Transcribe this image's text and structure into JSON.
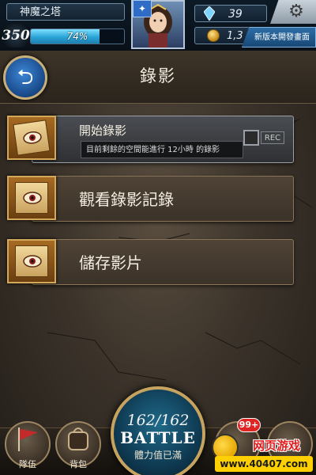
{
  "header": {
    "tower_name": "神魔之塔",
    "level": "350",
    "exp_percent": 74,
    "exp_label": "74%",
    "gems": "39",
    "coins": "1,3",
    "update_button": "新版本開發畫面"
  },
  "page": {
    "title": "錄影"
  },
  "menu": {
    "start": {
      "label": "開始錄影",
      "subtitle": "目前剩餘的空間能進行 12小時 的錄影",
      "toggle_label": "REC"
    },
    "view": {
      "label": "觀看錄影記錄"
    },
    "save": {
      "label": "儲存影片"
    }
  },
  "bottom": {
    "team_label": "隊伍",
    "bag_label": "背包",
    "stamina": "162/162",
    "battle_label": "BATTLE",
    "stamina_status": "體力值已滿",
    "badge": "99+"
  },
  "watermark": {
    "title": "网页游戏",
    "url": "www.40407.com"
  },
  "colors": {
    "exp_fill": "#2aa3d6",
    "back_button": "#1a4c8c",
    "panel_border": "#8a7458",
    "badge": "#e02424"
  }
}
